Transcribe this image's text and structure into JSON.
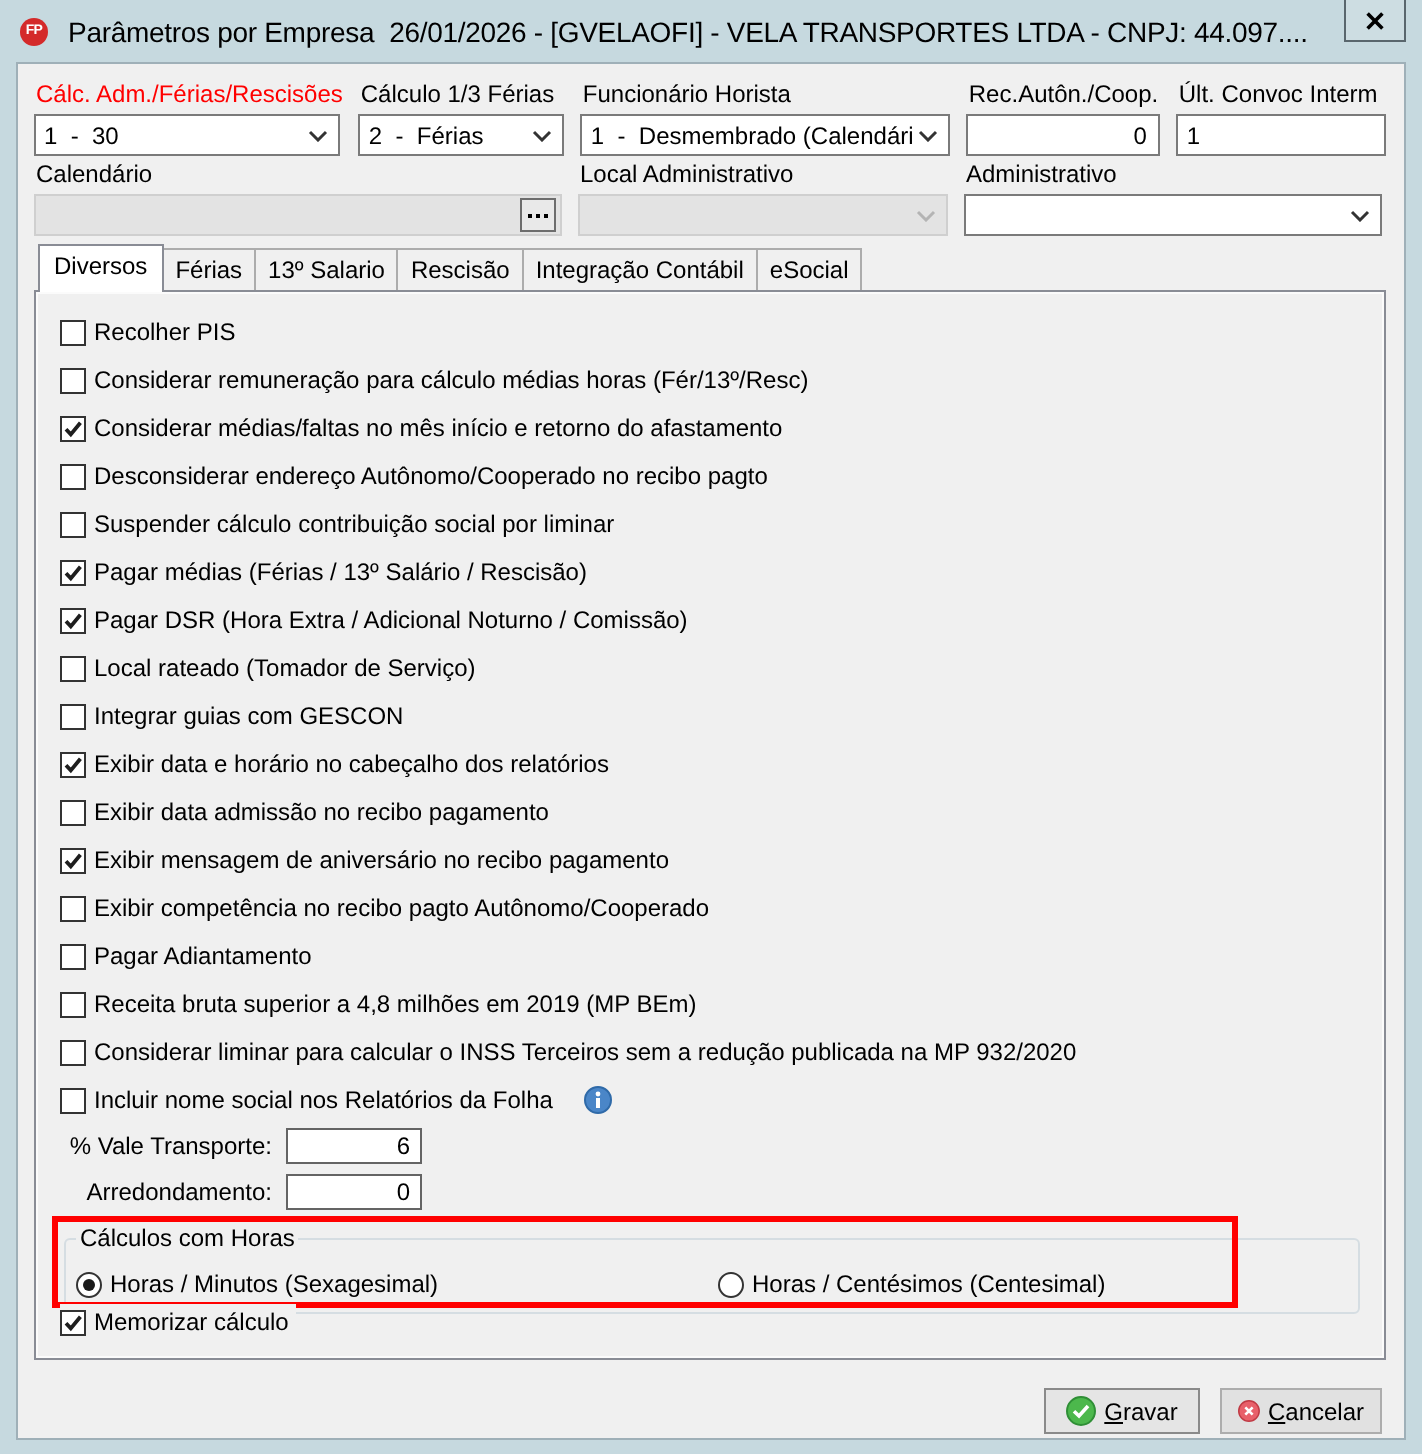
{
  "window": {
    "logo": "FP",
    "title": "Parâmetros por Empresa  26/01/2026 - [GVELAOFI] - VELA TRANSPORTES LTDA - CNPJ: 44.097...."
  },
  "field_rows": [
    [
      {
        "kind": "combo",
        "label": "Cálc. Adm./Férias/Rescisões",
        "highlighted": true,
        "disabled": false,
        "value": "1  -  30"
      },
      {
        "kind": "combo",
        "label": "Cálculo 1/3 Férias",
        "highlighted": false,
        "disabled": false,
        "value": "2  -  Férias"
      },
      {
        "kind": "combo",
        "label": "Funcionário Horista",
        "highlighted": false,
        "disabled": false,
        "value": "1  -  Desmembrado (Calendári"
      },
      {
        "kind": "number",
        "label": "Rec.Autôn./Coop.",
        "highlighted": false,
        "disabled": false,
        "value": "0"
      },
      {
        "kind": "text",
        "label": "Últ. Convoc Interm",
        "highlighted": false,
        "disabled": false,
        "value": "1"
      }
    ],
    [
      {
        "kind": "lookup",
        "label": "Calendário",
        "highlighted": false,
        "disabled": true
      },
      {
        "kind": "combo",
        "label": "Local Administrativo",
        "highlighted": false,
        "disabled": true
      },
      {
        "kind": "combo",
        "label": "Administrativo",
        "highlighted": false,
        "disabled": false
      }
    ]
  ],
  "tabs": [
    {
      "label": "Diversos",
      "selected": true
    },
    {
      "label": "Férias",
      "selected": false
    },
    {
      "label": "13º Salario",
      "selected": false
    },
    {
      "label": "Rescisão",
      "selected": false
    },
    {
      "label": "Integração Contábil",
      "selected": false
    },
    {
      "label": "eSocial",
      "selected": false
    }
  ],
  "options": [
    {
      "kind": "plain",
      "label": "Recolher PIS",
      "checked": false
    },
    {
      "kind": "plain",
      "label": "Considerar remuneração para cálculo médias horas (Fér/13º/Resc)",
      "checked": false
    },
    {
      "kind": "plain",
      "label": "Considerar médias/faltas no mês início e retorno do afastamento",
      "checked": true
    },
    {
      "kind": "plain",
      "label": "Desconsiderar endereço Autônomo/Cooperado no recibo pagto",
      "checked": false
    },
    {
      "kind": "plain",
      "label": "Suspender cálculo contribuição social por liminar",
      "checked": false
    },
    {
      "kind": "plain",
      "label": "Pagar médias (Férias / 13º Salário / Rescisão)",
      "checked": true
    },
    {
      "kind": "plain",
      "label": "Pagar DSR (Hora Extra / Adicional Noturno / Comissão)",
      "checked": true
    },
    {
      "kind": "plain",
      "label": "Local rateado (Tomador de Serviço)",
      "checked": false
    },
    {
      "kind": "plain",
      "label": "Integrar guias com GESCON",
      "checked": false
    },
    {
      "kind": "plain",
      "label": "Exibir data e horário no cabeçalho dos relatórios",
      "checked": true
    },
    {
      "kind": "plain",
      "label": "Exibir data admissão no recibo pagamento",
      "checked": false
    },
    {
      "kind": "plain",
      "label": "Exibir mensagem de aniversário no recibo pagamento",
      "checked": true
    },
    {
      "kind": "plain",
      "label": "Exibir competência no recibo pagto Autônomo/Cooperado",
      "checked": false
    },
    {
      "kind": "plain",
      "label": "Pagar Adiantamento",
      "checked": false
    },
    {
      "kind": "plain",
      "label": "Receita bruta superior a 4,8 milhões em 2019 (MP BEm)",
      "checked": false
    },
    {
      "kind": "plain",
      "label": "Considerar liminar para calcular o INSS Terceiros sem a redução publicada na MP 932/2020",
      "checked": false
    },
    {
      "kind": "info",
      "label": "Incluir nome social nos Relatórios da Folha",
      "checked": false
    }
  ],
  "number_fields": [
    {
      "label": "% Vale Transporte:",
      "value": "6"
    },
    {
      "label": "Arredondamento:",
      "value": "0"
    }
  ],
  "hours_group": {
    "title": "Cálculos com Horas",
    "options": [
      {
        "label": "Horas / Minutos (Sexagesimal)",
        "selected": true
      },
      {
        "label": "Horas / Centésimos (Centesimal)",
        "selected": false
      }
    ]
  },
  "memorize": {
    "label": "Memorizar cálculo",
    "checked": true
  },
  "buttons": [
    {
      "kind": "save",
      "label": "Gravar"
    },
    {
      "kind": "cancel",
      "label": "Cancelar"
    }
  ]
}
